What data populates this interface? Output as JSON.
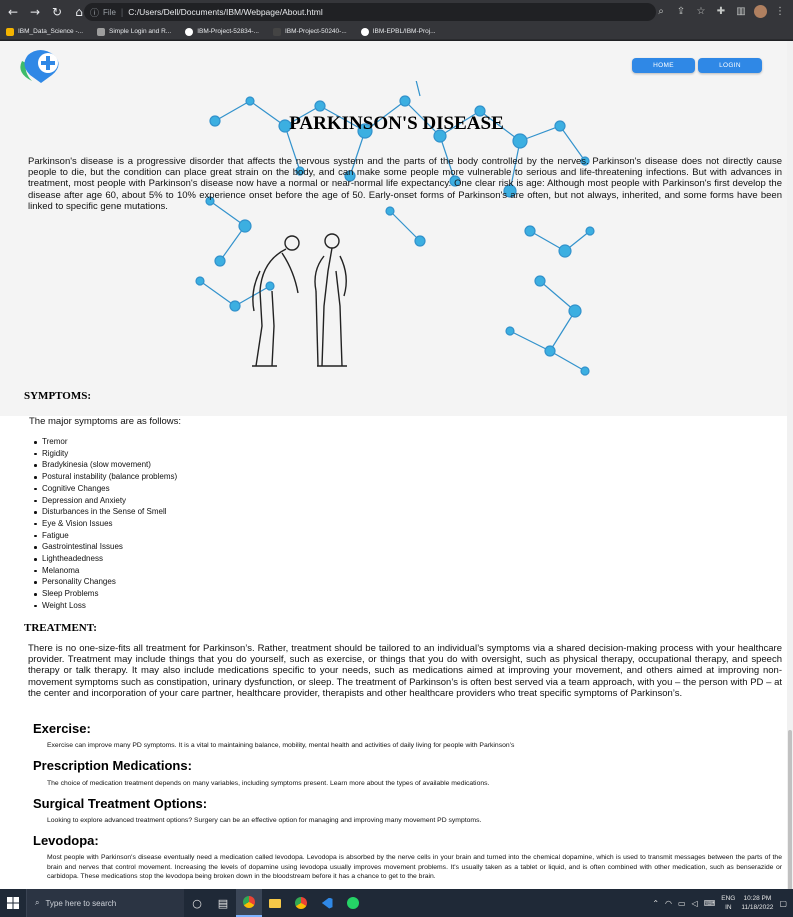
{
  "browser": {
    "omnibox_info": "ⓘ",
    "file_label": "File",
    "url": "C:/Users/Dell/Documents/IBM/Webpage/About.html",
    "bookmarks": [
      {
        "label": "IBM_Data_Science -...",
        "color": "#f4b400"
      },
      {
        "label": "Simple Login and R...",
        "color": "#9e9e9e"
      },
      {
        "label": "IBM-Project-52834-...",
        "color": "#ffffff"
      },
      {
        "label": "IBM-Project-50240-...",
        "color": "#444444"
      },
      {
        "label": "IBM-EPBL/IBM-Proj...",
        "color": "#ffffff"
      }
    ]
  },
  "nav": {
    "home": "HOME",
    "login": "LOGIN"
  },
  "page": {
    "title": "PARKINSON'S DISEASE",
    "intro": "Parkinson's disease is a progressive disorder that affects the nervous system and the parts of the body controlled by the nerves. Parkinson's disease does not directly cause people to die, but the condition can place great strain on the body, and can make some people more vulnerable to serious and life-threatening infections. But with advances in treatment, most people with Parkinson's disease now have a normal or near-normal life expectancy. One clear risk is age: Although most people with Parkinson's first develop the disease after age 60, about 5% to 10% experience onset before the age of 50. Early-onset forms of Parkinson's are often, but not always, inherited, and some forms have been linked to specific gene mutations.",
    "symptoms_heading": "SYMPTOMS:",
    "symptoms_intro": "The major symptoms are as follows:",
    "symptoms": [
      "Tremor",
      "Rigidity",
      "Bradykinesia (slow movement)",
      "Postural instability (balance problems)",
      "Cognitive Changes",
      "Depression and Anxiety",
      "Disturbances in the Sense of Smell",
      "Eye & Vision Issues",
      "Fatigue",
      "Gastrointestinal Issues",
      "Lightheadedness",
      "Melanoma",
      "Personality Changes",
      "Sleep Problems",
      "Weight Loss"
    ],
    "treatment_heading": "TREATMENT:",
    "treatment_text": "There is no one-size-fits all treatment for Parkinson’s. Rather, treatment should be tailored to an individual’s symptoms via a shared decision-making process with your healthcare provider. Treatment may include things that you do yourself, such as exercise, or things that you do with oversight, such as physical therapy, occupational therapy, and speech therapy or talk therapy. It may also include medications specific to your needs, such as medications aimed at improving your movement, and others aimed at improving non-movement symptoms such as constipation, urinary dysfunction, or sleep. The treatment of Parkinson’s is often best served via a team approach, with you – the person with PD – at the center and incorporation of your care partner, healthcare provider, therapists and other healthcare providers who treat specific symptoms of Parkinson’s.",
    "exercise_heading": "Exercise:",
    "exercise_text": "Exercise can improve many PD symptoms. It is a vital to maintaining balance, mobility, mental health and activities of daily living for people with Parkinson’s",
    "medications_heading": "Prescription Medications:",
    "medications_text": "The choice of medication treatment depends on many variables, including symptoms present. Learn more about the types of available medications.",
    "surgical_heading": "Surgical Treatment Options:",
    "surgical_text": "Looking to explore advanced treatment options? Surgery can be an effective option for managing and improving many movement PD symptoms.",
    "levodopa_heading": "Levodopa:",
    "levodopa_text": "Most people with Parkinson's disease eventually need a medication called levodopa. Levodopa is absorbed by the nerve cells in your brain and turned into the chemical dopamine, which is used to transmit messages between the parts of the brain and nerves that control movement. Increasing the levels of dopamine using levodopa usually improves movement problems. It's usually taken as a tablet or liquid, and is often combined with other medication, such as benserazide or carbidopa. These medications stop the levodopa being broken down in the bloodstream before it has a chance to get to the brain."
  },
  "taskbar": {
    "search_placeholder": "Type here to search",
    "lang_top": "ENG",
    "lang_bottom": "IN",
    "time": "10:28 PM",
    "date": "11/18/2022"
  },
  "colors": {
    "accent": "#2f88e6",
    "molecule": "#29a8e0"
  }
}
